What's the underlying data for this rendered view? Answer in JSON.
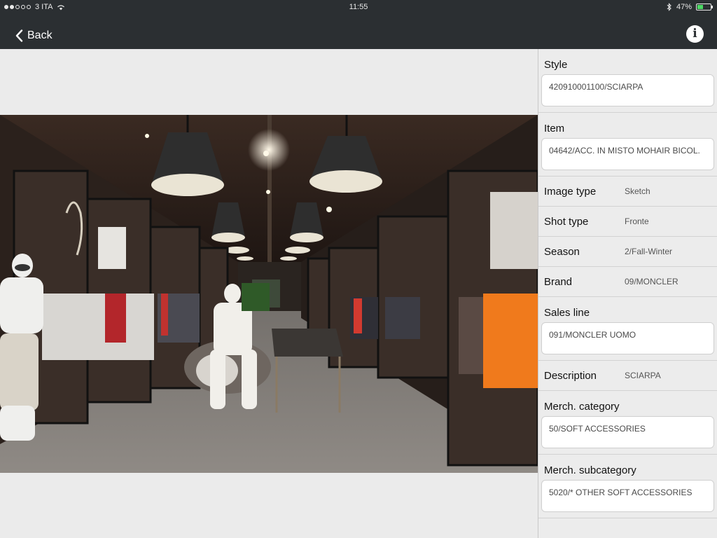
{
  "status_bar": {
    "carrier": "3 ITA",
    "time": "11:55",
    "battery": "47%",
    "battery_level": 0.47
  },
  "nav": {
    "back_label": "Back",
    "info_icon": "info-icon"
  },
  "details": {
    "style": {
      "label": "Style",
      "value": "420910001100/SCIARPA"
    },
    "item": {
      "label": "Item",
      "value": "04642/ACC. IN MISTO MOHAIR BICOL."
    },
    "image_type": {
      "label": "Image type",
      "value": "Sketch"
    },
    "shot_type": {
      "label": "Shot type",
      "value": "Fronte"
    },
    "season": {
      "label": "Season",
      "value": "2/Fall-Winter"
    },
    "brand": {
      "label": "Brand",
      "value": "09/MONCLER"
    },
    "sales_line": {
      "label": "Sales line",
      "value": "091/MONCLER UOMO"
    },
    "description": {
      "label": "Description",
      "value": "SCIARPA"
    },
    "merch_category": {
      "label": "Merch. category",
      "value": "50/SOFT ACCESSORIES"
    },
    "merch_subcategory": {
      "label": "Merch. subcategory",
      "value": "5020/* OTHER SOFT ACCESSORIES"
    }
  },
  "colors": {
    "nav_bg": "#2b2f32",
    "panel_bg": "#ececec",
    "page_bg": "#ebebeb",
    "battery_fill": "#4cd964"
  }
}
